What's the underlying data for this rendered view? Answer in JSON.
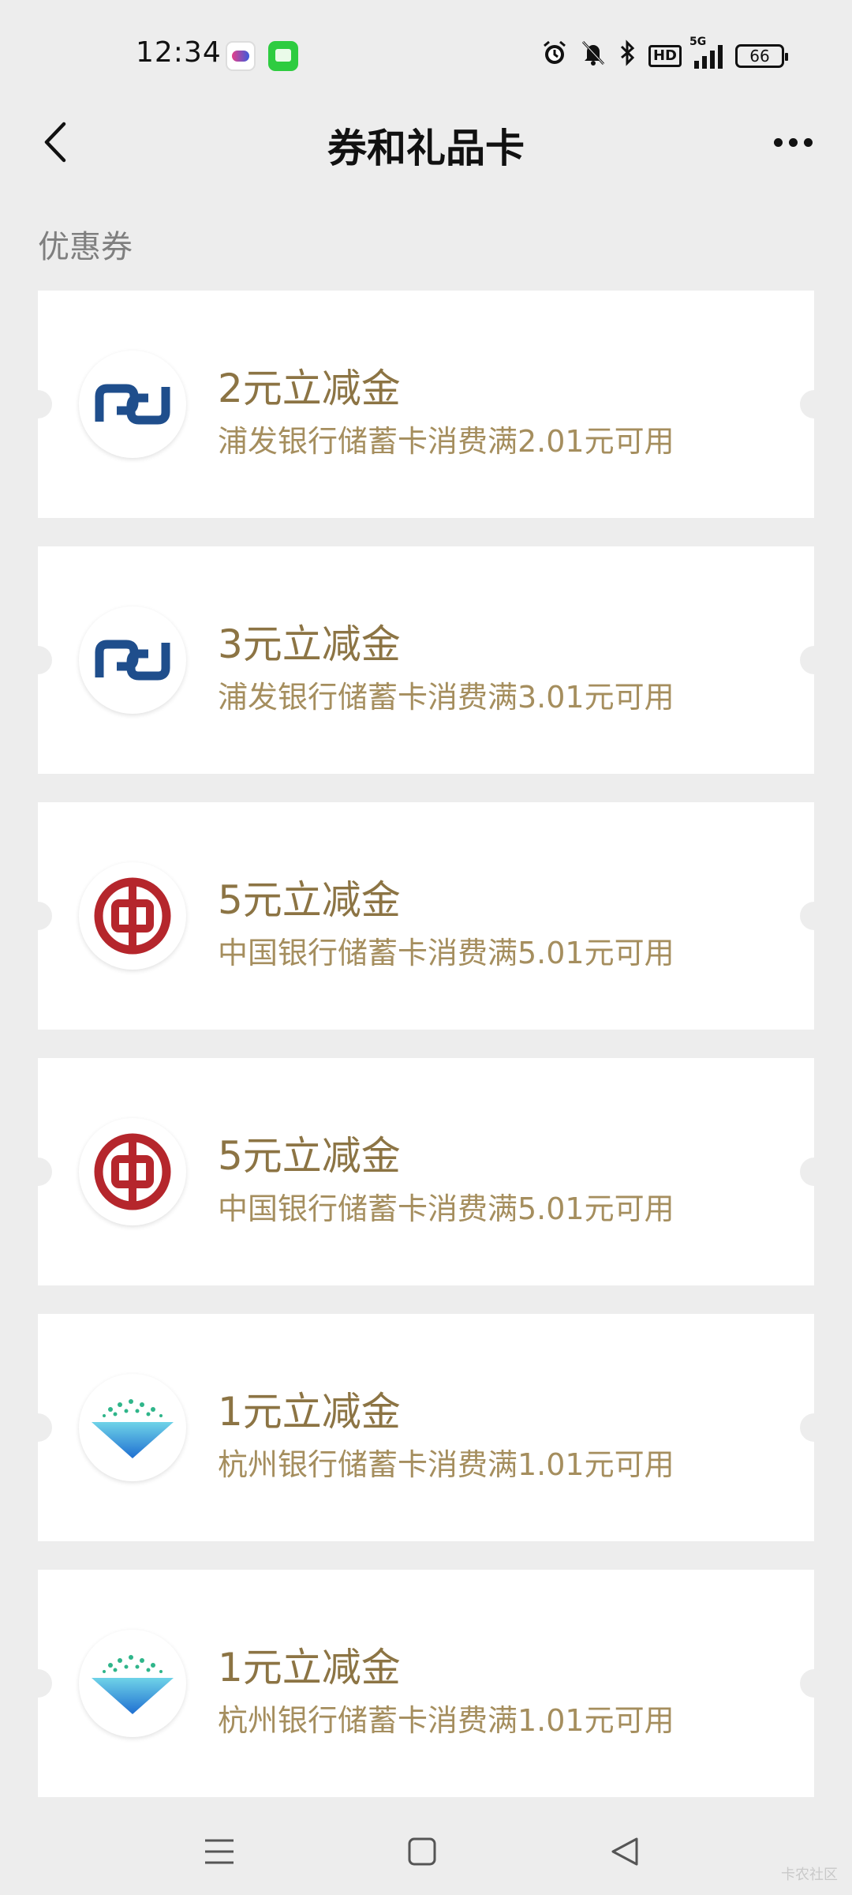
{
  "status_bar": {
    "time": "12:34",
    "network": "5G",
    "hd_label": "HD",
    "battery": "66",
    "icons": [
      "alarm-icon",
      "mute-bell-icon",
      "bluetooth-icon",
      "hd-icon",
      "signal-icon",
      "battery-icon"
    ]
  },
  "nav": {
    "back_icon": "chevron-left-icon",
    "title": "券和礼品卡",
    "more_icon": "more-dots-icon"
  },
  "section": {
    "label": "优惠券"
  },
  "coupons": [
    {
      "title": "2元立减金",
      "desc": "浦发银行储蓄卡消费满2.01元可用",
      "bank_logo": "spdb-logo"
    },
    {
      "title": "3元立减金",
      "desc": "浦发银行储蓄卡消费满3.01元可用",
      "bank_logo": "spdb-logo"
    },
    {
      "title": "5元立减金",
      "desc": "中国银行储蓄卡消费满5.01元可用",
      "bank_logo": "boc-logo"
    },
    {
      "title": "5元立减金",
      "desc": "中国银行储蓄卡消费满5.01元可用",
      "bank_logo": "boc-logo"
    },
    {
      "title": "1元立减金",
      "desc": "杭州银行储蓄卡消费满1.01元可用",
      "bank_logo": "hzbank-logo"
    },
    {
      "title": "1元立减金",
      "desc": "杭州银行储蓄卡消费满1.01元可用",
      "bank_logo": "hzbank-logo"
    }
  ],
  "system_nav": {
    "icons": [
      "menu-icon",
      "home-icon",
      "back-triangle-icon"
    ]
  },
  "watermark": "卡农社区",
  "colors": {
    "background": "#ededed",
    "coupon_title": "#8c7444",
    "coupon_desc": "#a58e5e",
    "spdb_blue": "#1f4e8c",
    "boc_red": "#b5262c",
    "hz_blue": "#2f8fd8"
  }
}
